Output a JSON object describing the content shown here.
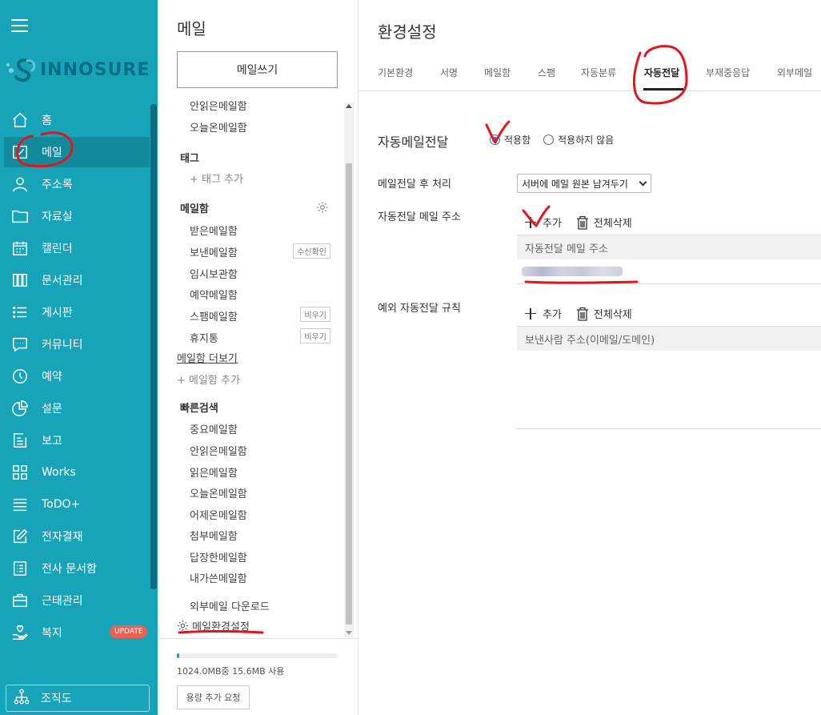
{
  "nav": {
    "menu_icon": "hamburger-icon",
    "logo_text": "INNOSURE",
    "items": [
      {
        "label": "홈",
        "icon": "home-icon"
      },
      {
        "label": "메일",
        "icon": "mail-icon"
      },
      {
        "label": "주소록",
        "icon": "person-icon"
      },
      {
        "label": "자료실",
        "icon": "folder-icon"
      },
      {
        "label": "캘린더",
        "icon": "calendar-icon"
      },
      {
        "label": "문서관리",
        "icon": "documents-icon"
      },
      {
        "label": "게시판",
        "icon": "list-icon"
      },
      {
        "label": "커뮤니티",
        "icon": "chat-icon"
      },
      {
        "label": "예약",
        "icon": "clock-icon"
      },
      {
        "label": "설문",
        "icon": "pie-chart-icon"
      },
      {
        "label": "보고",
        "icon": "report-icon"
      },
      {
        "label": "Works",
        "icon": "grid-icon"
      },
      {
        "label": "ToDO+",
        "icon": "stack-icon"
      },
      {
        "label": "전자결재",
        "icon": "edit-icon"
      },
      {
        "label": "전사 문서함",
        "icon": "archive-icon"
      },
      {
        "label": "근태관리",
        "icon": "briefcase-icon"
      },
      {
        "label": "복지",
        "icon": "heart-hand-icon"
      }
    ],
    "update_badge": "UPDATE",
    "org_chart": {
      "label": "조직도",
      "icon": "org-chart-icon"
    }
  },
  "mail": {
    "title": "메일",
    "compose": "메일쓰기",
    "top_items": [
      "안읽은메일함",
      "오늘온메일함"
    ],
    "tags_header": "태그",
    "add_tag": "태그 추가",
    "mailbox_header": "메일함",
    "mailboxes": [
      {
        "label": "받은메일함"
      },
      {
        "label": "보낸메일함",
        "button": "수신확인"
      },
      {
        "label": "임시보관함"
      },
      {
        "label": "예약메일함"
      },
      {
        "label": "스팸메일함",
        "button": "비우기"
      },
      {
        "label": "휴지통",
        "button": "비우기"
      }
    ],
    "more_mailboxes": "메일함 더보기",
    "add_mailbox": "메일함 추가",
    "quick_header": "빠른검색",
    "quick": [
      "중요메일함",
      "안읽은메일함",
      "읽은메일함",
      "오늘온메일함",
      "어제온메일함",
      "첨부메일함",
      "답장한메일함",
      "내가쓴메일함"
    ],
    "external_download": "외부메일 다운로드",
    "settings": "메일환경설정",
    "quota_fraction": 0.015,
    "quota_text": "1024.0MB중 15.6MB 사용",
    "quota_button": "용량 추가 요청"
  },
  "settings": {
    "title": "환경설정",
    "tabs": [
      "기본환경",
      "서명",
      "메일함",
      "스팸",
      "자동분류",
      "자동전달",
      "부재중응답",
      "외부메일"
    ],
    "active_tab": "자동전달",
    "section_title": "자동메일전달",
    "radio_on": "적용함",
    "radio_off": "적용하지 않음",
    "after_label": "메일전달 후 처리",
    "after_value": "서버에 메일 원본 남겨두기",
    "address_label": "자동전달 메일 주소",
    "add": "추가",
    "delete_all": "전체삭제",
    "address_column": "자동전달 메일 주소",
    "exception_label": "예외 자동전달 규칙",
    "exception_column": "보낸사람 주소(이메일/도메인)"
  },
  "colors": {
    "nav_bg": "#17a3b8",
    "nav_active": "#138a9c",
    "annotation": "#e0161e",
    "radio_on": "#1a73e8"
  }
}
